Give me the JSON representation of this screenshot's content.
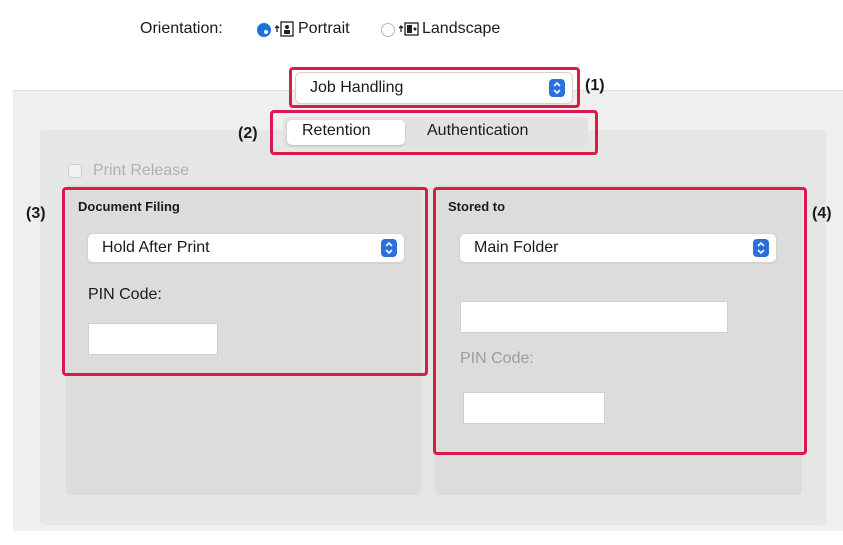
{
  "orientation": {
    "label": "Orientation:",
    "options": [
      {
        "label": "Portrait",
        "selected": true,
        "icon": "portrait-orientation-icon"
      },
      {
        "label": "Landscape",
        "selected": false,
        "icon": "landscape-orientation-icon"
      }
    ]
  },
  "panel_select": {
    "value": "Job Handling"
  },
  "tabs": [
    {
      "label": "Retention",
      "selected": true
    },
    {
      "label": "Authentication",
      "selected": false
    }
  ],
  "print_release": {
    "label": "Print Release",
    "checked": false,
    "enabled": false
  },
  "document_filing": {
    "title": "Document Filing",
    "mode": "Hold After Print",
    "pin_label": "PIN Code:",
    "pin_value": ""
  },
  "stored_to": {
    "title": "Stored to",
    "folder": "Main Folder",
    "folder_name_value": "",
    "pin_label": "PIN Code:",
    "pin_value": ""
  },
  "callouts": {
    "c1": "(1)",
    "c2": "(2)",
    "c3": "(3)",
    "c4": "(4)"
  },
  "colors": {
    "highlight": "#d81b48",
    "accent": "#1c6fe0"
  }
}
